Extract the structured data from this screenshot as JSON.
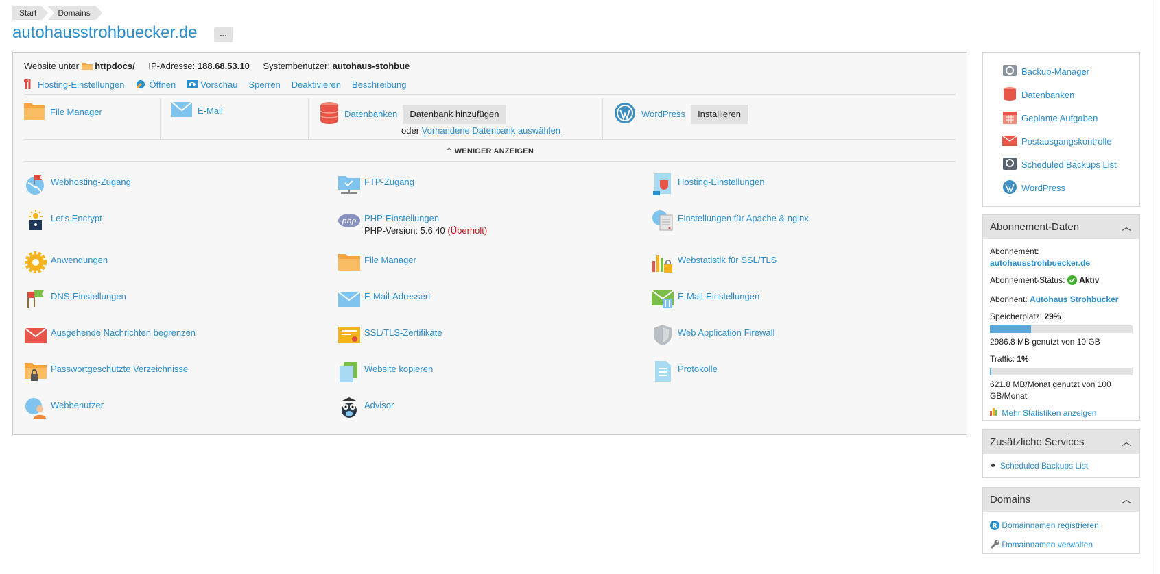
{
  "breadcrumb": {
    "items": [
      "Start",
      "Domains"
    ]
  },
  "page": {
    "title": "autohausstrohbuecker.de",
    "more_label": "..."
  },
  "info": {
    "website_label": "Website unter",
    "docroot": "httpdocs/",
    "ip_label": "IP-Adresse:",
    "ip_value": "188.68.53.10",
    "sysuser_label": "Systembenutzer:",
    "sysuser_value": "autohaus-stohbue"
  },
  "actions": [
    "Hosting-Einstellungen",
    "Öffnen",
    "Vorschau",
    "Sperren",
    "Deaktivieren",
    "Beschreibung"
  ],
  "quick": {
    "file_manager": "File Manager",
    "email": "E-Mail",
    "databases": "Datenbanken",
    "add_db": "Datenbank hinzufügen",
    "or": "oder",
    "select_db": "Vorhandene Datenbank auswählen",
    "wordpress": "WordPress",
    "install": "Installieren"
  },
  "toggle": {
    "label": "WENIGER ANZEIGEN"
  },
  "tools": {
    "col1": [
      "Webhosting-Zugang",
      "Let's Encrypt",
      "Anwendungen",
      "DNS-Einstellungen",
      "Ausgehende Nachrichten begrenzen",
      "Passwortgeschützte Verzeichnisse",
      "Webbenutzer"
    ],
    "col2": [
      "FTP-Zugang",
      "PHP-Einstellungen",
      "File Manager",
      "E-Mail-Adressen",
      "SSL/TLS-Zertifikate",
      "Website kopieren",
      "Advisor"
    ],
    "col3": [
      "Hosting-Einstellungen",
      "Einstellungen für Apache & nginx",
      "Webstatistik für SSL/TLS",
      "E-Mail-Einstellungen",
      "Web Application Firewall",
      "Protokolle"
    ],
    "php_version_label": "PHP-Version: 5.6.40",
    "php_outdated": "(Überholt)"
  },
  "sidebar": {
    "links": [
      "Backup-Manager",
      "Datenbanken",
      "Geplante Aufgaben",
      "Postausgangskontrolle",
      "Scheduled Backups List",
      "WordPress"
    ],
    "subscription": {
      "title": "Abonnement-Daten",
      "sub_label": "Abonnement:",
      "sub_value": "autohausstrohbuecker.de",
      "status_label": "Abonnement-Status:",
      "status_value": "Aktiv",
      "owner_label": "Abonnent:",
      "owner_value": "Autohaus Strohbücker",
      "disk_label": "Speicherplatz:",
      "disk_value": "29%",
      "disk_fraction": 0.29,
      "disk_text": "2986.8 MB genutzt von 10 GB",
      "traffic_label": "Traffic:",
      "traffic_value": "1%",
      "traffic_fraction": 0.01,
      "traffic_text": "621.8 MB/Monat genutzt von 100 GB/Monat",
      "stats_link": "Mehr Statistiken anzeigen"
    },
    "services": {
      "title": "Zusätzliche Services",
      "items": [
        "Scheduled Backups List"
      ]
    },
    "domains": {
      "title": "Domains",
      "register": "Domainnamen registrieren",
      "manage": "Domainnamen verwalten"
    }
  },
  "colors": {
    "link": "#2a8fce",
    "panel_header": "#e4e4e4",
    "bar_fill": "#5aa7d9",
    "warning": "#c4161c",
    "status_ok": "#3fae2a"
  }
}
